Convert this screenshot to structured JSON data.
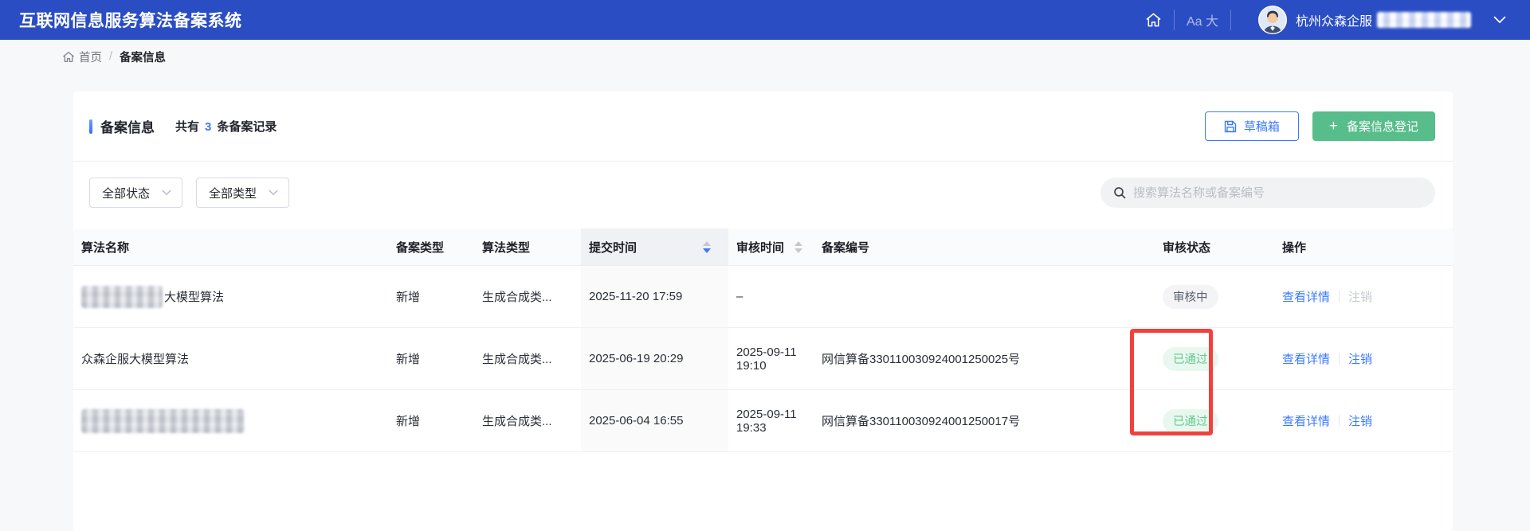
{
  "app": {
    "title": "互联网信息服务算法备案系统",
    "font_size_label": "Aa 大",
    "user_name": "杭州众森企服"
  },
  "breadcrumb": {
    "home": "首页",
    "separator": "/",
    "current": "备案信息"
  },
  "panel": {
    "title": "备案信息",
    "count_prefix": "共有",
    "count": "3",
    "count_suffix": "条备案记录",
    "draft_button_label": "草稿箱",
    "register_button_plus": "+",
    "register_button_label": "备案信息登记"
  },
  "filters": {
    "status_select": "全部状态",
    "type_select": "全部类型",
    "search_placeholder": "搜索算法名称或备案编号"
  },
  "table": {
    "columns": {
      "name": "算法名称",
      "filing_type": "备案类型",
      "algo_type": "算法类型",
      "submit_time": "提交时间",
      "review_time": "审核时间",
      "filing_no": "备案编号",
      "status": "审核状态",
      "actions": "操作"
    },
    "action_view": "查看详情",
    "action_cancel": "注销",
    "rows": [
      {
        "name": "大模型算法",
        "name_redacted_prefix": true,
        "filing_type": "新增",
        "algo_type": "生成合成类...",
        "submit_time": "2025-11-20 17:59",
        "review_time": "–",
        "filing_no": "",
        "status": "审核中"
      },
      {
        "name": "众森企服大模型算法",
        "filing_type": "新增",
        "algo_type": "生成合成类...",
        "submit_time": "2025-06-19 20:29",
        "review_time": "2025-09-11 19:10",
        "filing_no": "网信算备330110030924001250025号",
        "status": "已通过"
      },
      {
        "name": "",
        "name_redacted": true,
        "filing_type": "新增",
        "algo_type": "生成合成类...",
        "submit_time": "2025-06-04 16:55",
        "review_time": "2025-09-11 19:33",
        "filing_no": "网信算备330110030924001250017号",
        "status": "已通过"
      }
    ]
  },
  "colors": {
    "header_bg": "#2a4dc3",
    "link_blue": "#3a7afe",
    "primary_green": "#57bd8a",
    "pass_text": "#63c98e",
    "pass_bg": "#e9f8ef",
    "pending_text": "#595f6b",
    "pending_bg": "#f4f4f6",
    "annotation_red": "#f2413d",
    "page_bg": "#f7f8fa",
    "table_header_bg": "#fafbfc",
    "sorted_column_bg": "#fafafa"
  }
}
